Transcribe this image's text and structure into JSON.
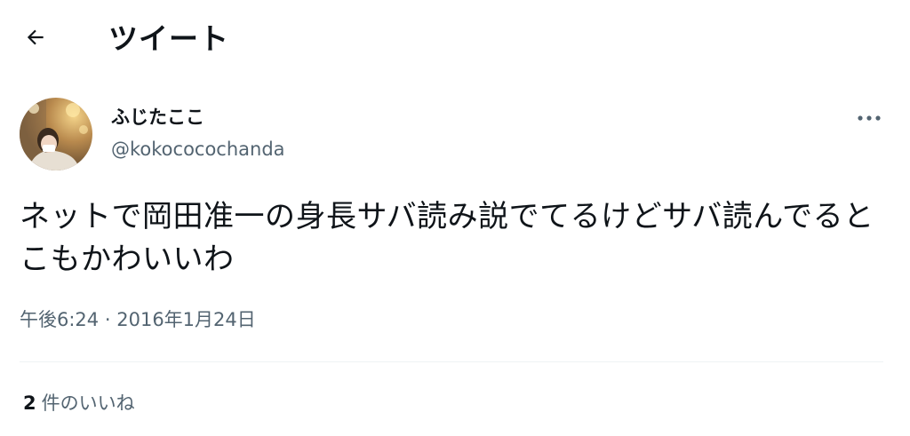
{
  "header": {
    "title": "ツイート",
    "back_icon": "arrow-left-icon"
  },
  "tweet": {
    "author": {
      "display_name": "ふじたここ",
      "handle": "@kokococochanda"
    },
    "more_icon": "more-horizontal-icon",
    "text": "ネットで岡田准一の身長サバ読み説でてるけどサバ読んでるとこもかわいいわ",
    "time": "午後6:24",
    "separator": "·",
    "date": "2016年1月24日",
    "likes": {
      "count": "2",
      "label": "件のいいね"
    }
  },
  "colors": {
    "text_primary": "#0f1419",
    "text_secondary": "#536471",
    "divider": "#eff3f4"
  }
}
